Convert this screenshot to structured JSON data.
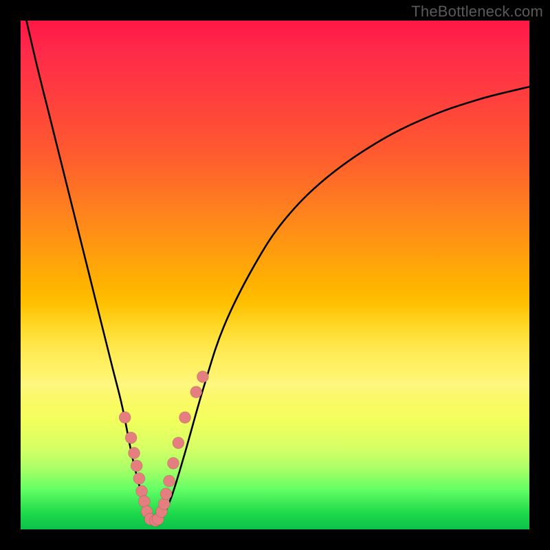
{
  "watermark": "TheBottleneck.com",
  "colors": {
    "marker": "#e57f7f",
    "curve": "#000000",
    "frame": "#000000"
  },
  "chart_data": {
    "type": "line",
    "title": "",
    "xlabel": "",
    "ylabel": "",
    "xlim": [
      0,
      100
    ],
    "ylim": [
      0,
      100
    ],
    "grid": false,
    "series": [
      {
        "name": "bottleneck-curve",
        "x": [
          0,
          3,
          6,
          9,
          12,
          15,
          18,
          20,
          22,
          24,
          25,
          26,
          27.5,
          29.5,
          32,
          36,
          40,
          46,
          52,
          60,
          70,
          80,
          90,
          100
        ],
        "y": [
          105,
          92,
          80,
          68,
          56,
          44,
          32,
          24,
          14,
          6,
          2,
          1.5,
          2,
          6,
          14,
          28,
          40,
          52,
          61,
          69,
          76,
          81,
          84.5,
          87
        ]
      }
    ],
    "markers": {
      "name": "highlighted-points",
      "x": [
        20.5,
        21.7,
        22.3,
        22.8,
        23.3,
        23.8,
        24.3,
        24.8,
        25.5,
        26.5,
        27.0,
        27.7,
        28.2,
        28.6,
        29.2,
        30.0,
        31.0,
        32.3,
        34.5,
        35.8
      ],
      "y": [
        22.0,
        18.0,
        15.0,
        12.5,
        10.0,
        7.5,
        5.5,
        3.5,
        2.0,
        1.7,
        2.0,
        3.5,
        5.0,
        7.0,
        9.5,
        13.0,
        17.0,
        22.0,
        27.0,
        30.0
      ]
    }
  }
}
